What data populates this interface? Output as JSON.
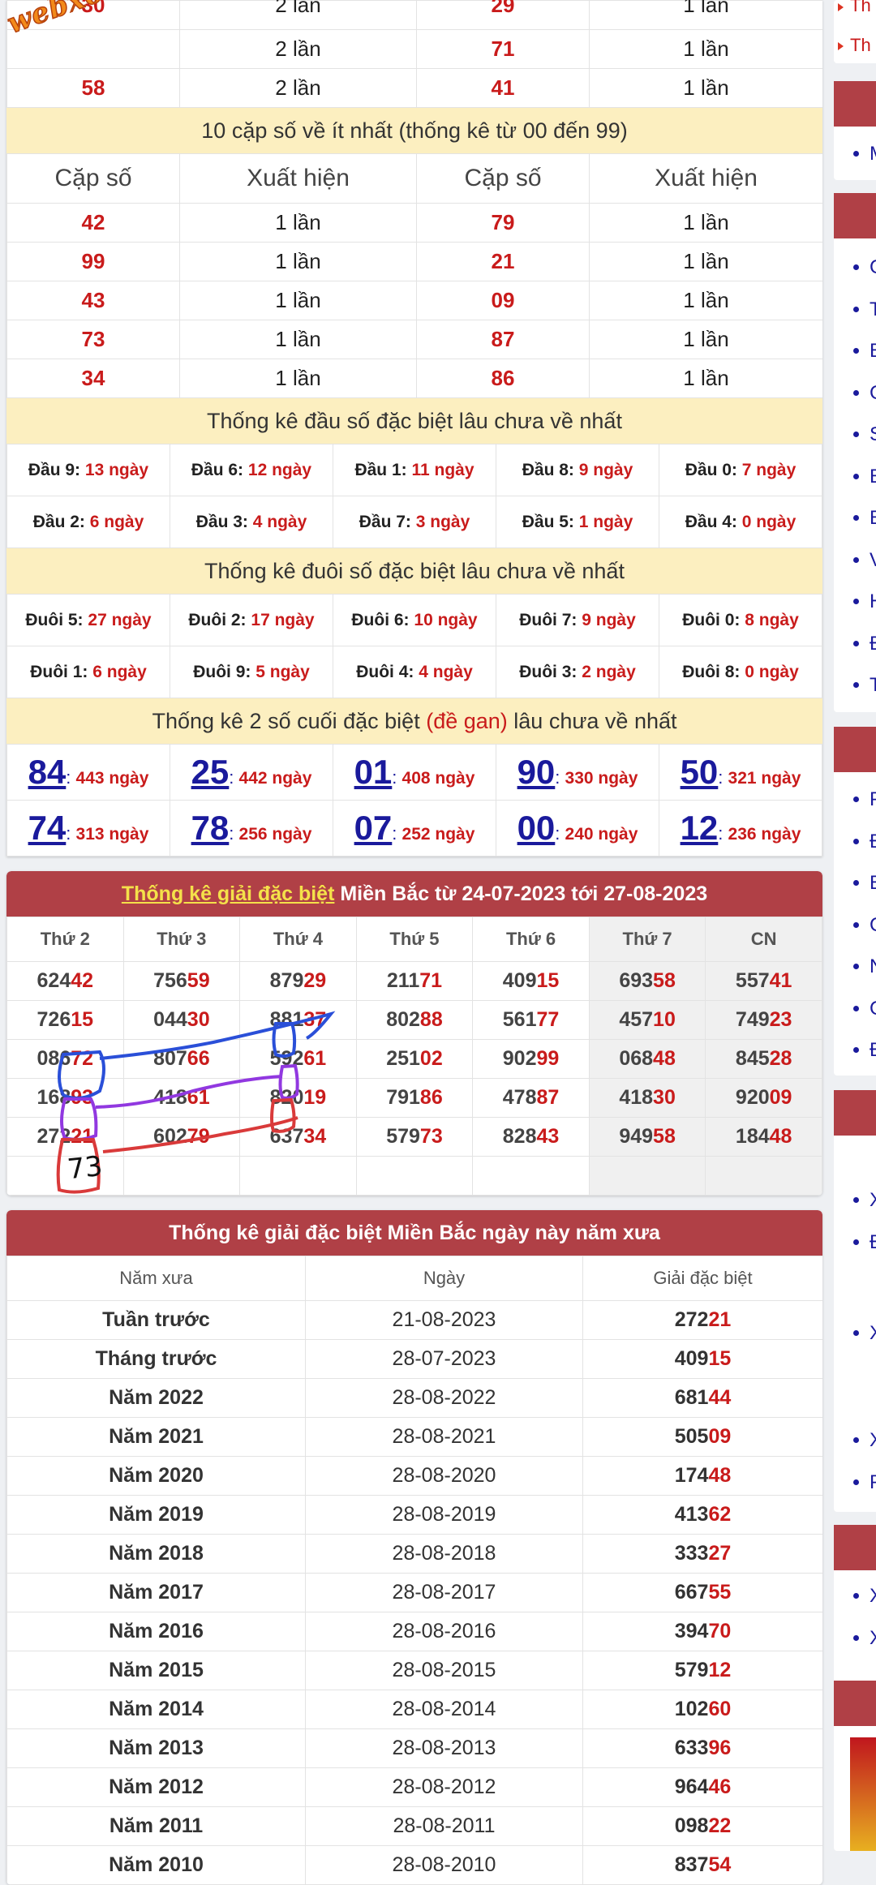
{
  "watermark": "webxoso.net",
  "top_pairs": {
    "rows": [
      {
        "a": "30",
        "ac": "2 lần",
        "b": "29",
        "bc": "1 lần"
      },
      {
        "a": "",
        "ac": "2 lần",
        "b": "71",
        "bc": "1 lần"
      },
      {
        "a": "58",
        "ac": "2 lần",
        "b": "41",
        "bc": "1 lần"
      }
    ]
  },
  "least_pairs": {
    "title": "10 cặp số về ít nhất (thống kê từ 00 đến 99)",
    "headers": [
      "Cặp số",
      "Xuất hiện",
      "Cặp số",
      "Xuất hiện"
    ],
    "rows": [
      {
        "a": "42",
        "ac": "1 lần",
        "b": "79",
        "bc": "1 lần"
      },
      {
        "a": "99",
        "ac": "1 lần",
        "b": "21",
        "bc": "1 lần"
      },
      {
        "a": "43",
        "ac": "1 lần",
        "b": "09",
        "bc": "1 lần"
      },
      {
        "a": "73",
        "ac": "1 lần",
        "b": "87",
        "bc": "1 lần"
      },
      {
        "a": "34",
        "ac": "1 lần",
        "b": "86",
        "bc": "1 lần"
      }
    ]
  },
  "head_stats": {
    "title": "Thống kê đầu số đặc biệt lâu chưa về nhất",
    "rows": [
      [
        {
          "l": "Đầu 9:",
          "v": "13 ngày"
        },
        {
          "l": "Đầu 6:",
          "v": "12 ngày"
        },
        {
          "l": "Đầu 1:",
          "v": "11 ngày"
        },
        {
          "l": "Đầu 8:",
          "v": "9 ngày"
        },
        {
          "l": "Đầu 0:",
          "v": "7 ngày"
        }
      ],
      [
        {
          "l": "Đầu 2:",
          "v": "6 ngày"
        },
        {
          "l": "Đầu 3:",
          "v": "4 ngày"
        },
        {
          "l": "Đầu 7:",
          "v": "3 ngày"
        },
        {
          "l": "Đầu 5:",
          "v": "1 ngày"
        },
        {
          "l": "Đầu 4:",
          "v": "0 ngày"
        }
      ]
    ]
  },
  "tail_stats": {
    "title": "Thống kê đuôi số đặc biệt lâu chưa về nhất",
    "rows": [
      [
        {
          "l": "Đuôi 5:",
          "v": "27 ngày"
        },
        {
          "l": "Đuôi 2:",
          "v": "17 ngày"
        },
        {
          "l": "Đuôi 6:",
          "v": "10 ngày"
        },
        {
          "l": "Đuôi 7:",
          "v": "9 ngày"
        },
        {
          "l": "Đuôi 0:",
          "v": "8 ngày"
        }
      ],
      [
        {
          "l": "Đuôi 1:",
          "v": "6 ngày"
        },
        {
          "l": "Đuôi 9:",
          "v": "5 ngày"
        },
        {
          "l": "Đuôi 4:",
          "v": "4 ngày"
        },
        {
          "l": "Đuôi 3:",
          "v": "2 ngày"
        },
        {
          "l": "Đuôi 8:",
          "v": "0 ngày"
        }
      ]
    ]
  },
  "gan_stats": {
    "title_pre": "Thống kê 2 số cuối đặc biệt ",
    "title_red": "(đề gan)",
    "title_post": " lâu chưa về nhất",
    "rows": [
      [
        {
          "n": "84",
          "d": "443 ngày"
        },
        {
          "n": "25",
          "d": "442 ngày"
        },
        {
          "n": "01",
          "d": "408 ngày"
        },
        {
          "n": "90",
          "d": "330 ngày"
        },
        {
          "n": "50",
          "d": "321 ngày"
        }
      ],
      [
        {
          "n": "74",
          "d": "313 ngày"
        },
        {
          "n": "78",
          "d": "256 ngày"
        },
        {
          "n": "07",
          "d": "252 ngày"
        },
        {
          "n": "00",
          "d": "240 ngày"
        },
        {
          "n": "12",
          "d": "236 ngày"
        }
      ]
    ]
  },
  "special_week": {
    "title_link": "Thống kê giải đặc biệt",
    "title_rest": " Miền Bắc từ 24-07-2023 tới 27-08-2023",
    "headers": [
      "Thứ 2",
      "Thứ 3",
      "Thứ 4",
      "Thứ 5",
      "Thứ 6",
      "Thứ 7",
      "CN"
    ],
    "rows": [
      [
        {
          "p": "624",
          "s": "42"
        },
        {
          "p": "756",
          "s": "59"
        },
        {
          "p": "879",
          "s": "29"
        },
        {
          "p": "211",
          "s": "71"
        },
        {
          "p": "409",
          "s": "15"
        },
        {
          "p": "693",
          "s": "58"
        },
        {
          "p": "557",
          "s": "41"
        }
      ],
      [
        {
          "p": "726",
          "s": "15"
        },
        {
          "p": "044",
          "s": "30"
        },
        {
          "p": "881",
          "s": "37"
        },
        {
          "p": "802",
          "s": "88"
        },
        {
          "p": "561",
          "s": "77"
        },
        {
          "p": "457",
          "s": "10"
        },
        {
          "p": "749",
          "s": "23"
        }
      ],
      [
        {
          "p": "086",
          "s": "72"
        },
        {
          "p": "807",
          "s": "66"
        },
        {
          "p": "592",
          "s": "61"
        },
        {
          "p": "251",
          "s": "02"
        },
        {
          "p": "902",
          "s": "99"
        },
        {
          "p": "068",
          "s": "48"
        },
        {
          "p": "845",
          "s": "28"
        }
      ],
      [
        {
          "p": "168",
          "s": "93"
        },
        {
          "p": "418",
          "s": "61"
        },
        {
          "p": "820",
          "s": "19"
        },
        {
          "p": "791",
          "s": "86"
        },
        {
          "p": "478",
          "s": "87"
        },
        {
          "p": "418",
          "s": "30"
        },
        {
          "p": "920",
          "s": "09"
        }
      ],
      [
        {
          "p": "272",
          "s": "21"
        },
        {
          "p": "602",
          "s": "79"
        },
        {
          "p": "637",
          "s": "34"
        },
        {
          "p": "579",
          "s": "73"
        },
        {
          "p": "828",
          "s": "43"
        },
        {
          "p": "949",
          "s": "58"
        },
        {
          "p": "184",
          "s": "48"
        }
      ]
    ],
    "handwritten": "73"
  },
  "history": {
    "title": "Thống kê giải đặc biệt Miền Bắc ngày này năm xưa",
    "headers": [
      "Năm xưa",
      "Ngày",
      "Giải đặc biệt"
    ],
    "rows": [
      {
        "y": "Tuần trước",
        "d": "21-08-2023",
        "p": "272",
        "s": "21"
      },
      {
        "y": "Tháng trước",
        "d": "28-07-2023",
        "p": "409",
        "s": "15"
      },
      {
        "y": "Năm 2022",
        "d": "28-08-2022",
        "p": "681",
        "s": "44"
      },
      {
        "y": "Năm 2021",
        "d": "28-08-2021",
        "p": "505",
        "s": "09"
      },
      {
        "y": "Năm 2020",
        "d": "28-08-2020",
        "p": "174",
        "s": "48"
      },
      {
        "y": "Năm 2019",
        "d": "28-08-2019",
        "p": "413",
        "s": "62"
      },
      {
        "y": "Năm 2018",
        "d": "28-08-2018",
        "p": "333",
        "s": "27"
      },
      {
        "y": "Năm 2017",
        "d": "28-08-2017",
        "p": "667",
        "s": "55"
      },
      {
        "y": "Năm 2016",
        "d": "28-08-2016",
        "p": "394",
        "s": "70"
      },
      {
        "y": "Năm 2015",
        "d": "28-08-2015",
        "p": "579",
        "s": "12"
      },
      {
        "y": "Năm 2014",
        "d": "28-08-2014",
        "p": "102",
        "s": "60"
      },
      {
        "y": "Năm 2013",
        "d": "28-08-2013",
        "p": "633",
        "s": "96"
      },
      {
        "y": "Năm 2012",
        "d": "28-08-2012",
        "p": "964",
        "s": "46"
      },
      {
        "y": "Năm 2011",
        "d": "28-08-2011",
        "p": "098",
        "s": "22"
      },
      {
        "y": "Năm 2010",
        "d": "28-08-2010",
        "p": "837",
        "s": "54"
      }
    ]
  },
  "sidebar": {
    "top_links": [
      "Th",
      "Th"
    ],
    "letters_a": [
      "M"
    ],
    "letters_b": [
      "C",
      "T",
      "B",
      "C",
      "S",
      "B",
      "B",
      "V",
      "H",
      "Đ",
      "T"
    ],
    "letters_c": [
      "P",
      "Đ",
      "B",
      "C",
      "N",
      "C",
      "Đ"
    ],
    "letters_d": [
      "X",
      "Đ"
    ],
    "letters_e": [
      "X"
    ],
    "letters_f": [
      "X",
      "P"
    ],
    "letters_g": [
      "X",
      "X"
    ]
  },
  "colors": {
    "accent_red": "#c91b1b",
    "header_bg": "#b04046",
    "yellow_bg": "#fcefc0",
    "link_blue": "#1a1a9c"
  }
}
